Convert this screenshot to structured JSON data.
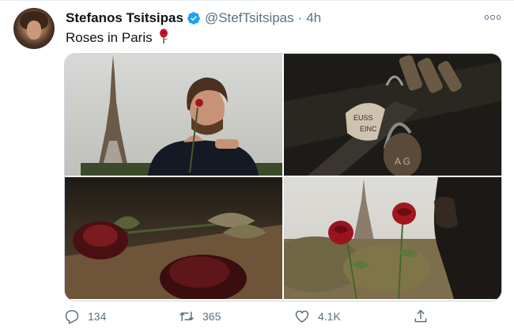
{
  "tweet": {
    "author_name": "Stefanos Tsitsipas",
    "author_handle": "@StefTsitsipas",
    "separator": "·",
    "timestamp": "4h",
    "text": "Roses in Paris",
    "text_emoji": "rose",
    "avatar": "profile-photo",
    "verified_icon": "verified-badge-icon",
    "verified_color": "#1da1f2",
    "more_icon": "more-options-icon",
    "media": [
      {
        "name": "man-with-rose-at-eiffel-tower"
      },
      {
        "name": "love-locks-closeup"
      },
      {
        "name": "roses-on-ground"
      },
      {
        "name": "rose-with-eiffel-tower"
      }
    ],
    "actions": {
      "reply": {
        "icon": "reply-icon",
        "count": "134"
      },
      "retweet": {
        "icon": "retweet-icon",
        "count": "365"
      },
      "like": {
        "icon": "heart-icon",
        "count": "4.1K"
      },
      "share": {
        "icon": "share-icon",
        "count": ""
      }
    },
    "colors": {
      "text": "#0f1419",
      "secondary": "#5b7083",
      "border": "#ccd6dd"
    }
  }
}
